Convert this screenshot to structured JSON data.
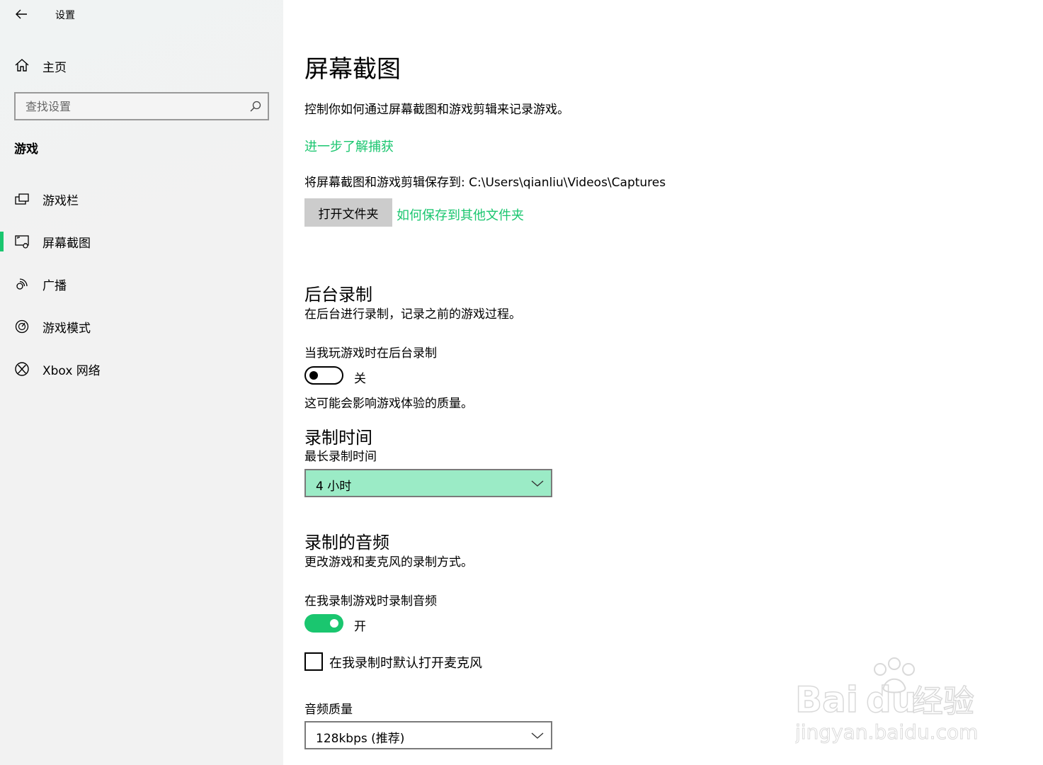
{
  "app": {
    "title": "设置"
  },
  "sidebar": {
    "home_label": "主页",
    "search_placeholder": "查找设置",
    "section_title": "游戏",
    "items": [
      {
        "label": "游戏栏",
        "icon": "game-bar-icon"
      },
      {
        "label": "屏幕截图",
        "icon": "captures-icon",
        "active": true
      },
      {
        "label": "广播",
        "icon": "broadcast-icon"
      },
      {
        "label": "游戏模式",
        "icon": "game-mode-icon"
      },
      {
        "label": "Xbox 网络",
        "icon": "xbox-icon"
      }
    ]
  },
  "main": {
    "title": "屏幕截图",
    "description": "控制你如何通过屏幕截图和游戏剪辑来记录游戏。",
    "learn_more_link": "进一步了解捕获",
    "save_path_text": "将屏幕截图和游戏剪辑保存到: C:\\Users\\qianliu\\Videos\\Captures",
    "open_folder_button": "打开文件夹",
    "other_folder_link": "如何保存到其他文件夹",
    "background": {
      "title": "后台录制",
      "description": "在后台进行录制，记录之前的游戏过程。",
      "toggle_label": "当我玩游戏时在后台录制",
      "toggle_state": "关",
      "note": "这可能会影响游戏体验的质量。"
    },
    "record_time": {
      "title": "录制时间",
      "label": "最长录制时间",
      "value": "4 小时"
    },
    "audio": {
      "title": "录制的音频",
      "description": "更改游戏和麦克风的录制方式。",
      "toggle_label": "在我录制游戏时录制音频",
      "toggle_state": "开",
      "mic_checkbox_label": "在我录制时默认打开麦克风",
      "quality_label": "音频质量",
      "quality_value": "128kbps (推荐)"
    }
  },
  "watermark": {
    "line1": "Bai",
    "line2": "du",
    "cn": "经验",
    "url": "jingyan.baidu.com"
  },
  "colors": {
    "accent": "#1ac66f",
    "selected_dropdown": "#9bebc6"
  }
}
